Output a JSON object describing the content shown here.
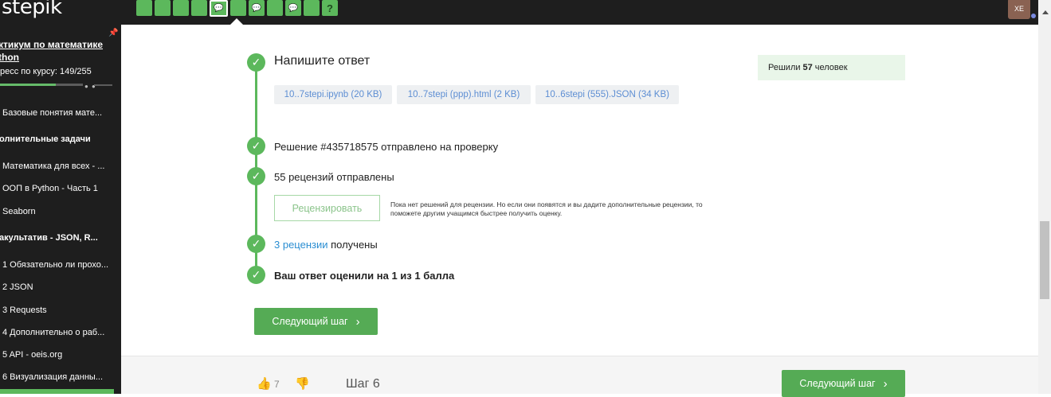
{
  "topbar": {
    "logo": "stepik",
    "step_icons": [
      "",
      "",
      "",
      "",
      "💬",
      "",
      "💬",
      "",
      "💬",
      "",
      "?"
    ],
    "active_step_index": 4,
    "avatar_initials": "XE"
  },
  "sidebar": {
    "course_title_line1": "ктикум по математике",
    "course_title_line2": "thon",
    "progress_label": "ресс по курсу:  149/255",
    "progress_fraction": 0.584,
    "items": [
      {
        "label": "Базовые понятия мате...",
        "section": false
      },
      {
        "label": "олнительные задачи",
        "section": true
      },
      {
        "label": "Математика для всех - ...",
        "section": false
      },
      {
        "label": "ООП в Python - Часть 1",
        "section": false
      },
      {
        "label": "Seaborn",
        "section": false
      },
      {
        "label": "акультатив - JSON, R...",
        "section": true
      },
      {
        "label": "1  Обязательно ли прохо...",
        "section": false
      },
      {
        "label": "2  JSON",
        "section": false
      },
      {
        "label": "3  Requests",
        "section": false
      },
      {
        "label": "4  Дополнительно о раб...",
        "section": false
      },
      {
        "label": "5  API - oeis.org",
        "section": false
      },
      {
        "label": "6  Визуализация данны...",
        "section": false
      }
    ]
  },
  "main": {
    "title": "Напишите ответ",
    "files": [
      "10..7stepi.ipynb (20 KB)",
      "10..7stepi (ppp).html (2 KB)",
      "10..6stepi (555).JSON (34 KB)"
    ],
    "solved_prefix": "Решили ",
    "solved_count": "57",
    "solved_suffix": " человек",
    "submission_text": "Решение #435718575 отправлено на проверку",
    "reviews_sent": "55 рецензий отправлены",
    "review_button": "Рецензировать",
    "review_note": "Пока нет решений для рецензии. Но если они появятся и вы дадите дополнительные рецензии, то поможете другим учащимся быстрее получить оценку.",
    "reviews_received_link": "3 рецензии",
    "reviews_received_suffix": " получены",
    "score_text": "Ваш ответ оценили на 1 из 1 балла",
    "next_step_button": "Следующий шаг"
  },
  "footer": {
    "likes": "7",
    "step_label": "Шаг 6",
    "next_step_button": "Следующий шаг"
  },
  "colors": {
    "accent_green": "#5cb85c",
    "link_blue": "#2b8ed2",
    "dark_bg": "#1e1e1e"
  }
}
